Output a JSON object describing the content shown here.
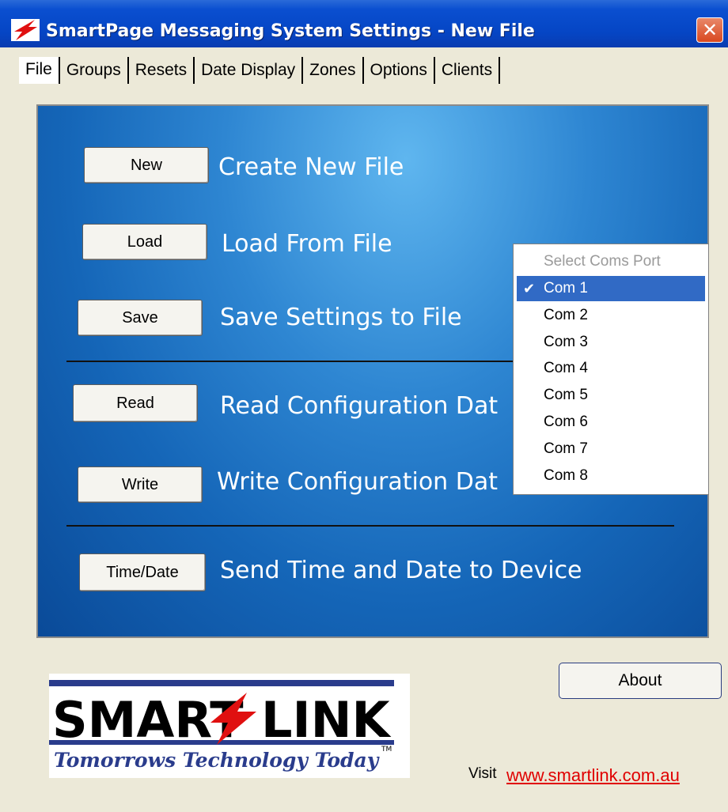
{
  "window": {
    "title": "SmartPage Messaging System Settings - New File",
    "close_label": "✕"
  },
  "tabs": [
    {
      "label": "File",
      "active": true
    },
    {
      "label": "Groups"
    },
    {
      "label": "Resets"
    },
    {
      "label": "Date Display"
    },
    {
      "label": "Zones"
    },
    {
      "label": "Options"
    },
    {
      "label": "Clients"
    }
  ],
  "actions": {
    "new": {
      "button": "New",
      "label": "Create New File"
    },
    "load": {
      "button": "Load",
      "label": "Load From File"
    },
    "save": {
      "button": "Save",
      "label": "Save Settings to File"
    },
    "read": {
      "button": "Read",
      "label": "Read Configuration Dat"
    },
    "write": {
      "button": "Write",
      "label": "Write Configuration Dat"
    },
    "timedate": {
      "button": "Time/Date",
      "label": "Send Time and Date to Device"
    }
  },
  "com_menu": {
    "header": "Select Coms Port",
    "items": [
      "Com 1",
      "Com 2",
      "Com 3",
      "Com 4",
      "Com 5",
      "Com 6",
      "Com 7",
      "Com 8"
    ],
    "selected": "Com 1"
  },
  "about_label": "About",
  "logo": {
    "brand_left": "SMART",
    "brand_right": "LINK",
    "tagline": "Tomorrows Technology Today",
    "tm": "TM"
  },
  "footer": {
    "visit": "Visit",
    "url": "www.smartlink.com.au"
  },
  "colors": {
    "titlebar": "#0545c4",
    "panel": "#1566b8",
    "menu_selected": "#316ac5",
    "link": "#e00000"
  }
}
